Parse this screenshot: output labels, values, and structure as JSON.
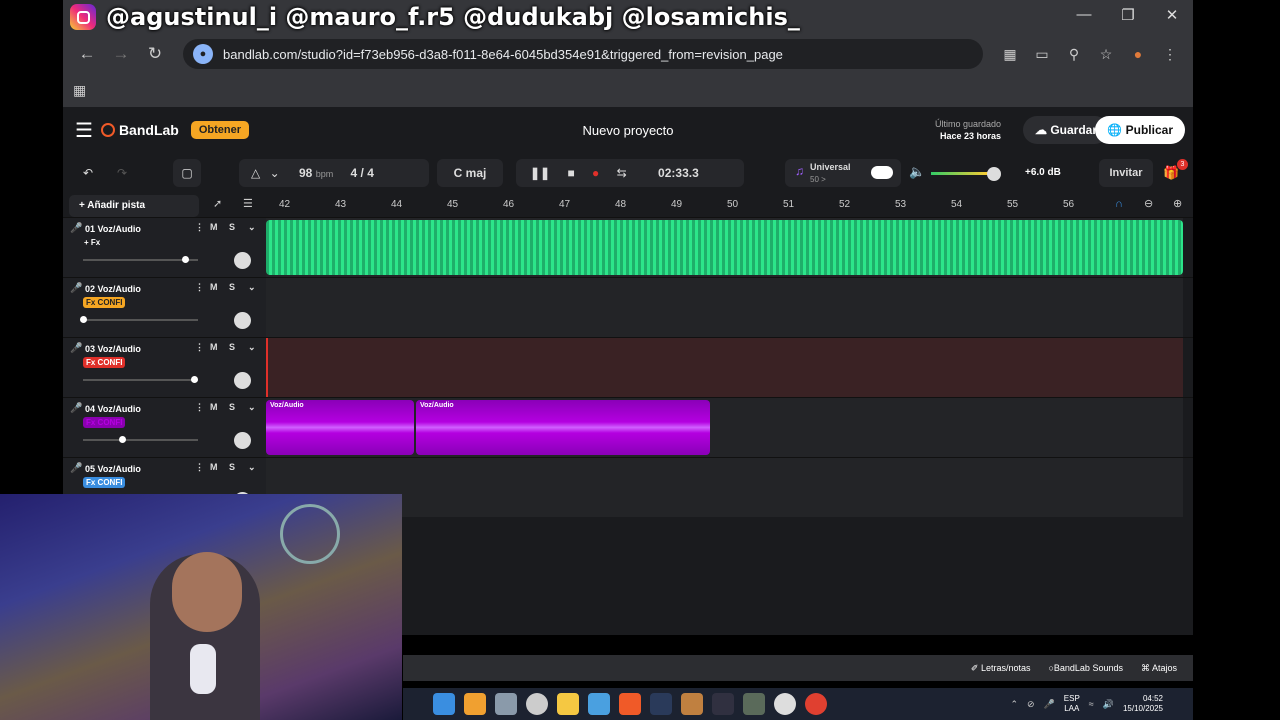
{
  "overlay": {
    "handles": "@agustinul_i  @mauro_f.r5  @dudukabj @losamichis_"
  },
  "browser": {
    "url": "bandlab.com/studio?id=f73eb956-d3a8-f011-8e64-6045bd354e91&triggered_from=revision_page"
  },
  "header": {
    "brand": "BandLab",
    "obtener": "Obtener",
    "project": "Nuevo proyecto",
    "saved_label": "Último guardado",
    "saved_time": "Hace 23 horas",
    "guardar": "Guardar",
    "publicar": "Publicar"
  },
  "transport": {
    "bpm": "98",
    "bpm_unit": "bpm",
    "signature": "4 / 4",
    "key": "C maj",
    "time": "02:33.3",
    "mode": "Universal",
    "mode_sub": "50 >",
    "gain": "+6.0 dB",
    "invitar": "Invitar",
    "gift_count": "3"
  },
  "toolbar": {
    "add_track": "Añadir pista"
  },
  "ruler": [
    "42",
    "43",
    "44",
    "45",
    "46",
    "47",
    "48",
    "49",
    "50",
    "51",
    "52",
    "53",
    "54",
    "55",
    "56"
  ],
  "tracks": [
    {
      "name": "01 Voz/Audio",
      "fx": "+ Fx",
      "color": "#2ecc71"
    },
    {
      "name": "02 Voz/Audio",
      "fx": "Fx CONFI",
      "color": "#f5a623"
    },
    {
      "name": "03 Voz/Audio",
      "fx": "Fx CONFI",
      "color": "#e0302a"
    },
    {
      "name": "04 Voz/Audio",
      "fx": "Fx CONFI",
      "color": "#b400e0"
    },
    {
      "name": "05 Voz/Audio",
      "fx": "Fx CONFI",
      "color": "#3a8ee0"
    }
  ],
  "clips": {
    "a": "Voz/Audio",
    "b": "Voz/Audio"
  },
  "footer": {
    "lyrics": "Letras/notas",
    "sounds": "BandLab Sounds",
    "shortcuts": "Atajos"
  },
  "taskbar": {
    "lang": "ESP",
    "lang2": "LAA",
    "time": "04:52",
    "date": "15/10/2025"
  }
}
